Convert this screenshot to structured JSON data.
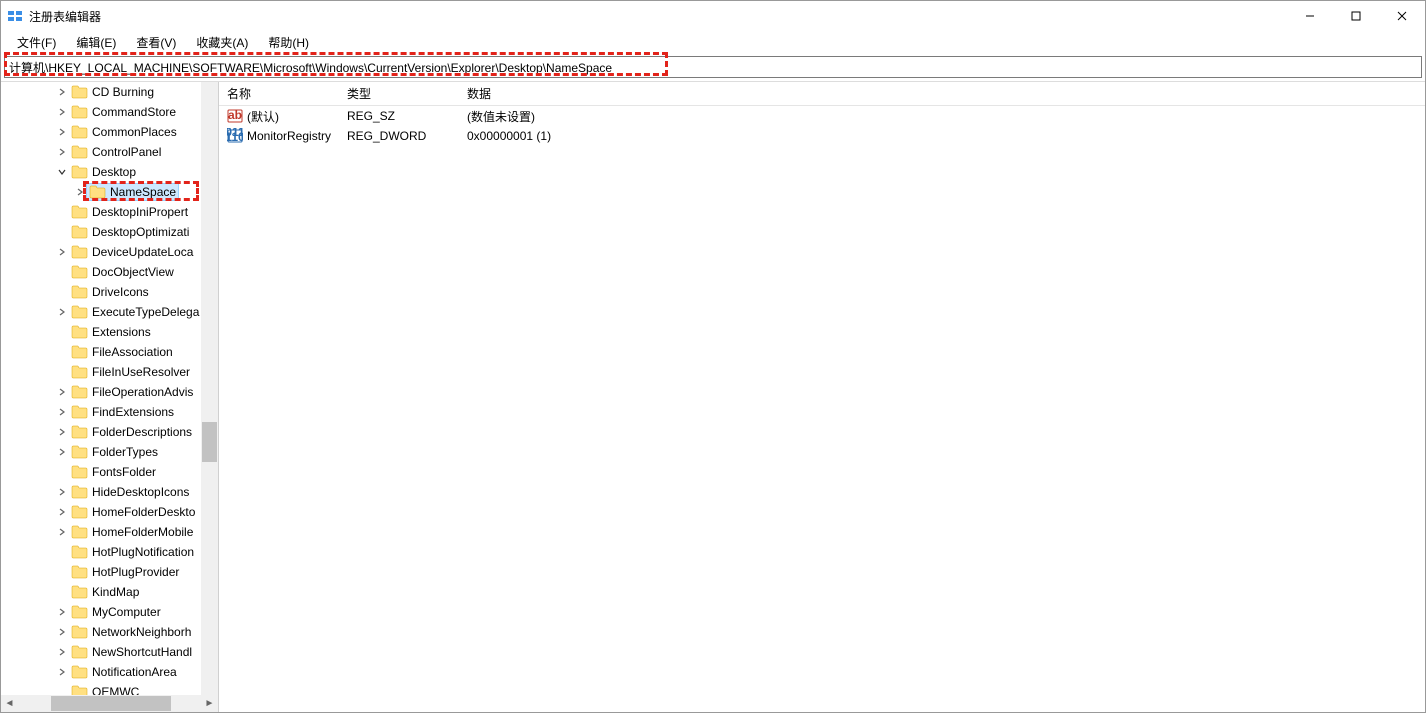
{
  "window": {
    "title": "注册表编辑器"
  },
  "menubar": {
    "items": [
      {
        "label": "文件(F)"
      },
      {
        "label": "编辑(E)"
      },
      {
        "label": "查看(V)"
      },
      {
        "label": "收藏夹(A)"
      },
      {
        "label": "帮助(H)"
      }
    ]
  },
  "addressbar": {
    "value": "计算机\\HKEY_LOCAL_MACHINE\\SOFTWARE\\Microsoft\\Windows\\CurrentVersion\\Explorer\\Desktop\\NameSpace"
  },
  "tree": {
    "items": [
      {
        "label": "CD Burning",
        "indent": 3,
        "chevron": ">"
      },
      {
        "label": "CommandStore",
        "indent": 3,
        "chevron": ">"
      },
      {
        "label": "CommonPlaces",
        "indent": 3,
        "chevron": ">"
      },
      {
        "label": "ControlPanel",
        "indent": 3,
        "chevron": ">"
      },
      {
        "label": "Desktop",
        "indent": 3,
        "chevron": "v"
      },
      {
        "label": "NameSpace",
        "indent": 4,
        "chevron": ">",
        "selected": true,
        "highlight": true
      },
      {
        "label": "DesktopIniPropert",
        "indent": 3,
        "chevron": ""
      },
      {
        "label": "DesktopOptimizati",
        "indent": 3,
        "chevron": ""
      },
      {
        "label": "DeviceUpdateLoca",
        "indent": 3,
        "chevron": ">"
      },
      {
        "label": "DocObjectView",
        "indent": 3,
        "chevron": ""
      },
      {
        "label": "DriveIcons",
        "indent": 3,
        "chevron": ""
      },
      {
        "label": "ExecuteTypeDelega",
        "indent": 3,
        "chevron": ">"
      },
      {
        "label": "Extensions",
        "indent": 3,
        "chevron": ""
      },
      {
        "label": "FileAssociation",
        "indent": 3,
        "chevron": ""
      },
      {
        "label": "FileInUseResolver",
        "indent": 3,
        "chevron": ""
      },
      {
        "label": "FileOperationAdvis",
        "indent": 3,
        "chevron": ">"
      },
      {
        "label": "FindExtensions",
        "indent": 3,
        "chevron": ">"
      },
      {
        "label": "FolderDescriptions",
        "indent": 3,
        "chevron": ">"
      },
      {
        "label": "FolderTypes",
        "indent": 3,
        "chevron": ">"
      },
      {
        "label": "FontsFolder",
        "indent": 3,
        "chevron": ""
      },
      {
        "label": "HideDesktopIcons",
        "indent": 3,
        "chevron": ">"
      },
      {
        "label": "HomeFolderDeskto",
        "indent": 3,
        "chevron": ">"
      },
      {
        "label": "HomeFolderMobile",
        "indent": 3,
        "chevron": ">"
      },
      {
        "label": "HotPlugNotification",
        "indent": 3,
        "chevron": ""
      },
      {
        "label": "HotPlugProvider",
        "indent": 3,
        "chevron": ""
      },
      {
        "label": "KindMap",
        "indent": 3,
        "chevron": ""
      },
      {
        "label": "MyComputer",
        "indent": 3,
        "chevron": ">"
      },
      {
        "label": "NetworkNeighborh",
        "indent": 3,
        "chevron": ">"
      },
      {
        "label": "NewShortcutHandl",
        "indent": 3,
        "chevron": ">"
      },
      {
        "label": "NotificationArea",
        "indent": 3,
        "chevron": ">"
      },
      {
        "label": "OEMWC",
        "indent": 3,
        "chevron": ""
      }
    ]
  },
  "list": {
    "headers": {
      "name": "名称",
      "type": "类型",
      "data": "数据"
    },
    "rows": [
      {
        "icon": "string",
        "name": "(默认)",
        "type": "REG_SZ",
        "data": "(数值未设置)"
      },
      {
        "icon": "binary",
        "name": "MonitorRegistry",
        "type": "REG_DWORD",
        "data": "0x00000001 (1)"
      }
    ]
  }
}
